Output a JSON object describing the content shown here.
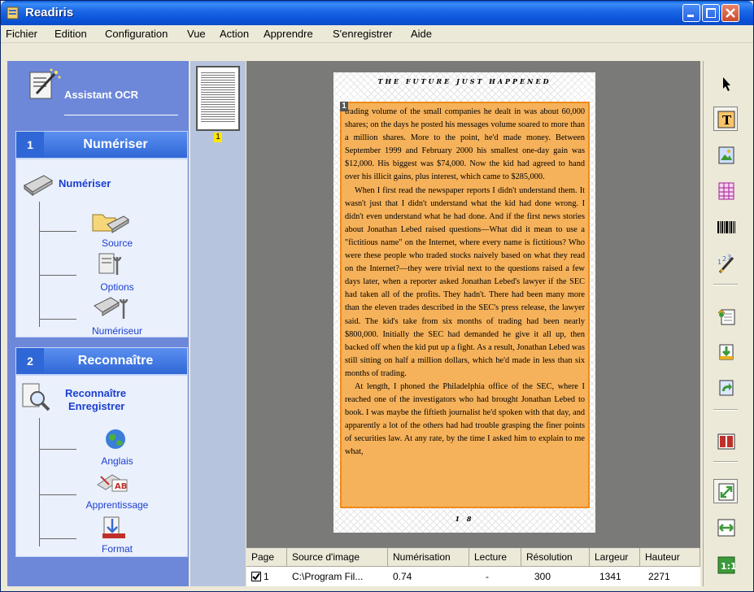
{
  "window": {
    "title": "Readiris"
  },
  "menu": [
    "Fichier",
    "Edition",
    "Configuration",
    "Vue",
    "Action",
    "Apprendre",
    "S'enregistrer",
    "Aide"
  ],
  "assistant": {
    "label": "Assistant OCR"
  },
  "step1": {
    "number": "1",
    "title": "Numériser",
    "main_label": "Numériser",
    "items": [
      "Source",
      "Options",
      "Numériseur"
    ]
  },
  "step2": {
    "number": "2",
    "title": "Reconnaître",
    "main_label_line1": "Reconnaître",
    "main_label_line2": "Enregistrer",
    "items": [
      "Anglais",
      "Apprentissage",
      "Format"
    ]
  },
  "thumbnail": {
    "page_number": "1"
  },
  "document": {
    "header": "THE FUTURE JUST HAPPENED",
    "block_number": "1",
    "paragraphs": [
      "trading volume of the small companies he dealt in was about 60,000 shares; on the days he posted his messages volume soared to more than a million shares. More to the point, he'd made money. Between September 1999 and February 2000 his smallest one-day gain was $12,000. His biggest was $74,000. Now the kid had agreed to hand over his illicit gains, plus interest, which came to $285,000.",
      "When I first read the newspaper reports I didn't understand them. It wasn't just that I didn't understand what the kid had done wrong. I didn't even understand what he had done. And if the first news stories about Jonathan Lebed raised questions—What did it mean to use a \"fictitious name\" on the Internet, where every name is fictitious? Who were these people who traded stocks naively based on what they read on the Internet?—they were trivial next to the questions raised a few days later, when a reporter asked Jonathan Lebed's lawyer if the SEC had taken all of the profits. They hadn't. There had been many more than the eleven trades described in the SEC's press release, the lawyer said. The kid's take from six months of trading had been nearly $800,000. Initially the SEC had demanded he give it all up, then backed off when the kid put up a fight. As a result, Jonathan Lebed was still sitting on half a million dollars, which he'd made in less than six months of trading.",
      "At length, I phoned the Philadelphia office of the SEC, where I reached one of the investigators who had brought Jonathan Lebed to book. I was maybe the fiftieth journalist he'd spoken with that day, and apparently a lot of the others had had trouble grasping the finer points of securities law. At any rate, by the time I asked him to explain to me what,"
    ],
    "page_number": "1 8"
  },
  "table": {
    "headers": [
      "Page",
      "Source d'image",
      "Numérisation",
      "Lecture",
      "Résolution",
      "Largeur",
      "Hauteur"
    ],
    "row": [
      "1",
      "C:\\Program Fil...",
      "0.74",
      "-",
      "300",
      "1341",
      "2271"
    ]
  }
}
